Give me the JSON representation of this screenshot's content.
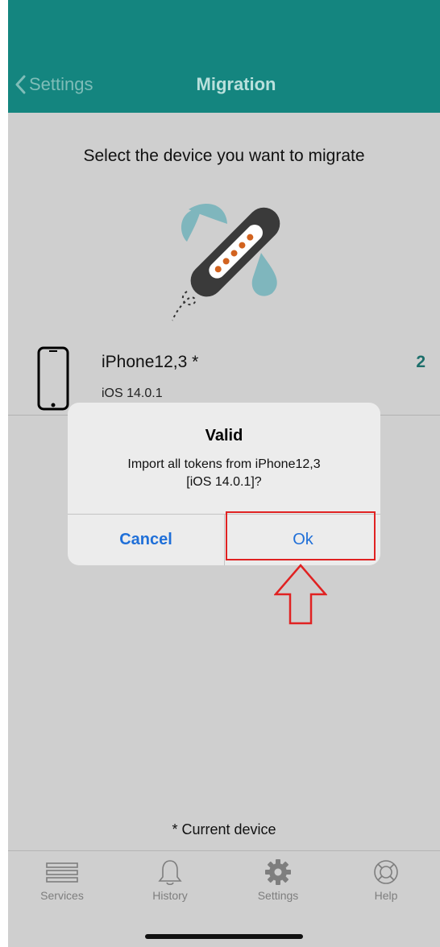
{
  "header": {
    "back_label": "Settings",
    "title": "Migration"
  },
  "main": {
    "prompt": "Select the device you want to migrate",
    "device": {
      "name": "iPhone12,3 *",
      "os": "iOS 14.0.1",
      "count": "2"
    },
    "footnote": "* Current device"
  },
  "alert": {
    "title": "Valid",
    "message_line1": "Import all tokens from iPhone12,3",
    "message_line2": "[iOS 14.0.1]?",
    "cancel_label": "Cancel",
    "ok_label": "Ok"
  },
  "tabbar": {
    "items": [
      {
        "label": "Services",
        "icon": "list-icon"
      },
      {
        "label": "History",
        "icon": "bell-icon"
      },
      {
        "label": "Settings",
        "icon": "gear-icon"
      },
      {
        "label": "Help",
        "icon": "lifebuoy-icon"
      }
    ],
    "active": "Settings"
  },
  "colors": {
    "header": "#14857f",
    "accent_count": "#1d6f6b",
    "alert_button": "#1f6fd8",
    "highlight": "#e02222"
  }
}
